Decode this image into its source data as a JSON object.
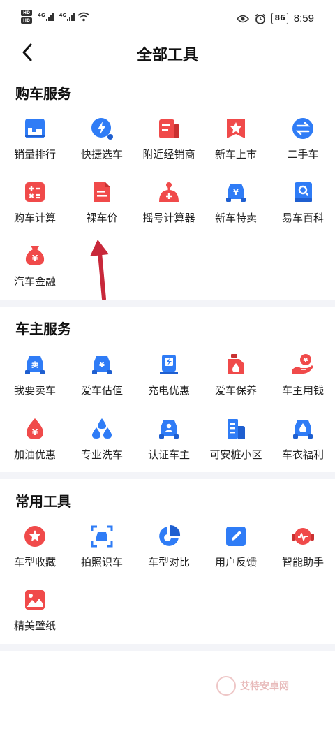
{
  "status": {
    "hd1": "HD",
    "hd2": "HD",
    "net1": "4G",
    "net2": "4G",
    "battery": "86",
    "time": "8:59",
    "icons": [
      "hd-icon",
      "signal-icon",
      "wifi-icon",
      "eye-icon",
      "alarm-icon",
      "battery-icon"
    ]
  },
  "header": {
    "title": "全部工具",
    "back_icon": "chevron-left-icon"
  },
  "sections": [
    {
      "title": "购车服务",
      "tools": [
        {
          "label": "销量排行",
          "icon": "sales-rank-icon",
          "color": "#2f7cf6"
        },
        {
          "label": "快捷选车",
          "icon": "quick-select-icon",
          "color": "#2f7cf6"
        },
        {
          "label": "附近经销商",
          "icon": "dealer-icon",
          "color": "#f04a4a"
        },
        {
          "label": "新车上市",
          "icon": "new-car-icon",
          "color": "#f04a4a"
        },
        {
          "label": "二手车",
          "icon": "exchange-icon",
          "color": "#2f7cf6"
        },
        {
          "label": "购车计算",
          "icon": "calculator-icon",
          "color": "#f04a4a"
        },
        {
          "label": "裸车价",
          "icon": "document-icon",
          "color": "#f04a4a"
        },
        {
          "label": "摇号计算器",
          "icon": "lottery-icon",
          "color": "#f04a4a"
        },
        {
          "label": "新车特卖",
          "icon": "car-price-icon",
          "color": "#2f7cf6"
        },
        {
          "label": "易车百科",
          "icon": "encyclopedia-icon",
          "color": "#2f7cf6"
        },
        {
          "label": "汽车金融",
          "icon": "money-bag-icon",
          "color": "#f04a4a"
        }
      ]
    },
    {
      "title": "车主服务",
      "tools": [
        {
          "label": "我要卖车",
          "icon": "sell-car-icon",
          "color": "#2f7cf6"
        },
        {
          "label": "爱车估值",
          "icon": "car-value-icon",
          "color": "#2f7cf6"
        },
        {
          "label": "充电优惠",
          "icon": "charging-icon",
          "color": "#2f7cf6"
        },
        {
          "label": "爱车保养",
          "icon": "oil-icon",
          "color": "#f04a4a"
        },
        {
          "label": "车主用钱",
          "icon": "hand-money-icon",
          "color": "#f04a4a"
        },
        {
          "label": "加油优惠",
          "icon": "fuel-drop-icon",
          "color": "#f04a4a"
        },
        {
          "label": "专业洗车",
          "icon": "car-wash-icon",
          "color": "#2f7cf6"
        },
        {
          "label": "认证车主",
          "icon": "verified-owner-icon",
          "color": "#2f7cf6"
        },
        {
          "label": "可安桩小区",
          "icon": "building-icon",
          "color": "#2f7cf6"
        },
        {
          "label": "车衣福利",
          "icon": "car-cover-icon",
          "color": "#2f7cf6"
        }
      ]
    },
    {
      "title": "常用工具",
      "tools": [
        {
          "label": "车型收藏",
          "icon": "favorite-icon",
          "color": "#f04a4a"
        },
        {
          "label": "拍照识车",
          "icon": "scan-car-icon",
          "color": "#2f7cf6"
        },
        {
          "label": "车型对比",
          "icon": "pie-chart-icon",
          "color": "#2f7cf6"
        },
        {
          "label": "用户反馈",
          "icon": "edit-icon",
          "color": "#2f7cf6"
        },
        {
          "label": "智能助手",
          "icon": "assistant-icon",
          "color": "#f04a4a"
        },
        {
          "label": "精美壁纸",
          "icon": "wallpaper-icon",
          "color": "#f04a4a"
        }
      ]
    }
  ],
  "annotation": {
    "arrow_color": "#c8283a",
    "icon": "arrow-up-icon"
  },
  "watermark": {
    "text": "艾特安卓网",
    "icon": "watermark-logo-icon"
  }
}
